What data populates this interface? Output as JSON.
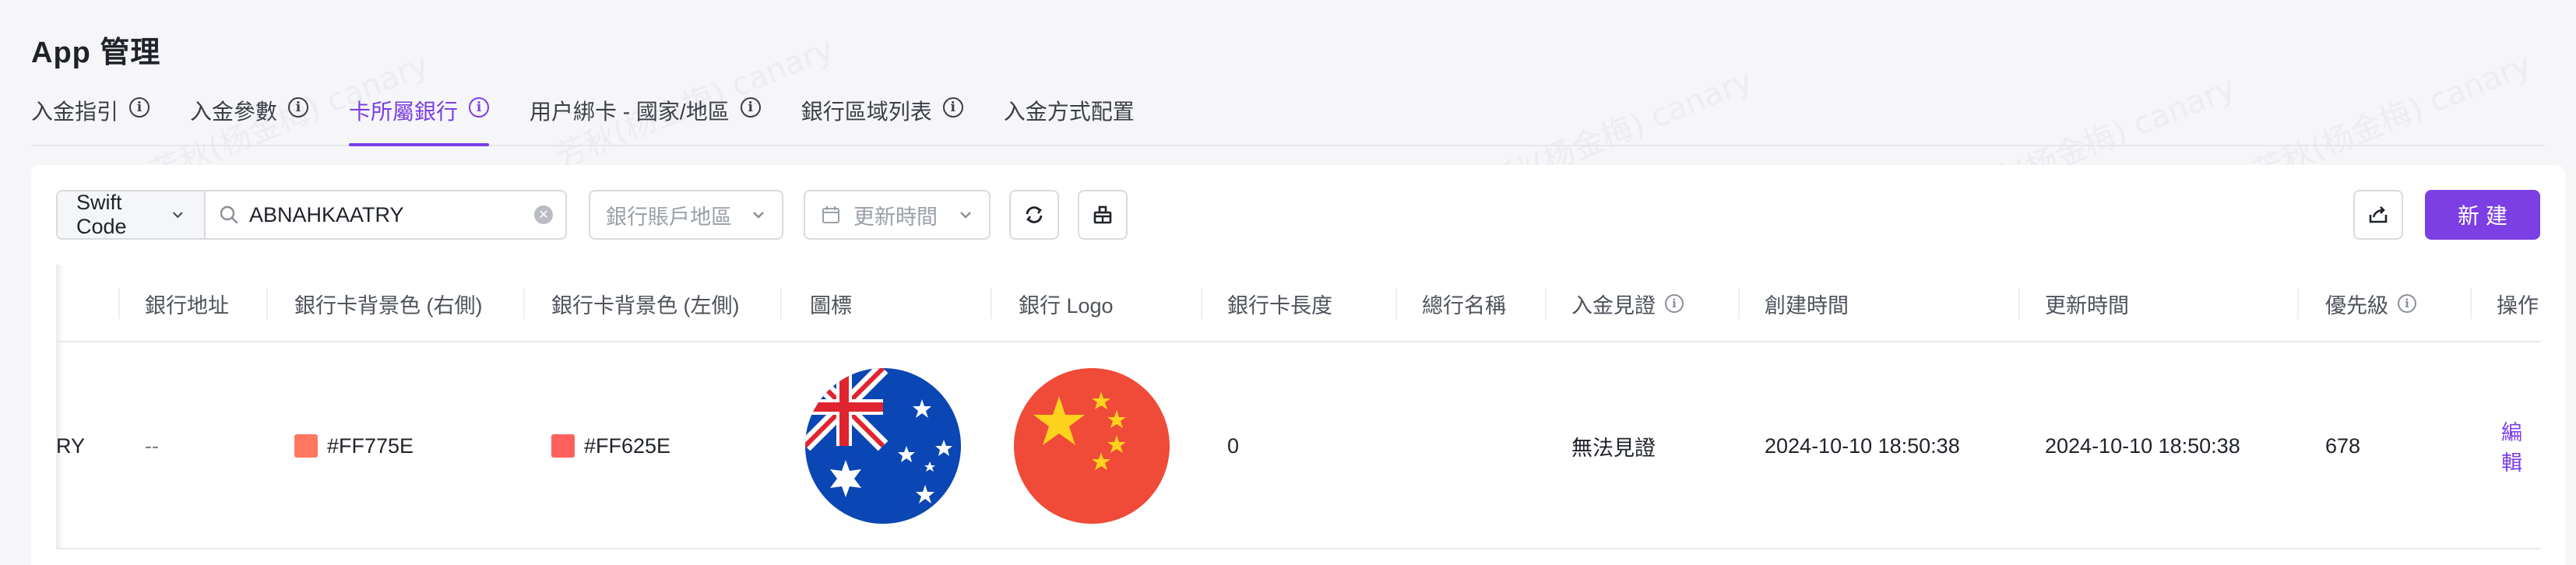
{
  "page": {
    "title": "App 管理"
  },
  "tabs": [
    {
      "label": "入金指引",
      "has_info": true,
      "active": false
    },
    {
      "label": "入金參數",
      "has_info": true,
      "active": false
    },
    {
      "label": "卡所屬銀行",
      "has_info": true,
      "active": true
    },
    {
      "label": "用户綁卡 - 國家/地區",
      "has_info": true,
      "active": false
    },
    {
      "label": "銀行區域列表",
      "has_info": true,
      "active": false
    },
    {
      "label": "入金方式配置",
      "has_info": false,
      "active": false
    }
  ],
  "toolbar": {
    "field_select": "Swift Code",
    "search_value": "ABNAHKAATRY",
    "region_placeholder": "銀行賬戶地區",
    "update_time_placeholder": "更新時間",
    "refresh_icon": "refresh-icon",
    "clear_filter_icon": "broom-icon",
    "export_icon": "export-icon",
    "new_label": "新建"
  },
  "table": {
    "columns": [
      "",
      "銀行地址",
      "銀行卡背景色 (右側)",
      "銀行卡背景色 (左側)",
      "圖標",
      "銀行 Logo",
      "銀行卡長度",
      "總行名稱",
      "入金見證",
      "創建時間",
      "更新時間",
      "優先級",
      "操作"
    ],
    "rows": [
      {
        "swift_tail": "RY",
        "address": "--",
        "bg_right": "#FF775E",
        "bg_left": "#FF625E",
        "icon": "australia-flag-icon",
        "logo": "china-flag-icon",
        "card_length": "0",
        "hq_name": "",
        "deposit_proof": "無法見證",
        "created_at": "2024-10-10 18:50:38",
        "updated_at": "2024-10-10 18:50:38",
        "priority": "678",
        "action": "編輯"
      }
    ]
  },
  "watermark": "芳秋(杨金梅) canary",
  "colors": {
    "accent": "#7b3fe4"
  }
}
